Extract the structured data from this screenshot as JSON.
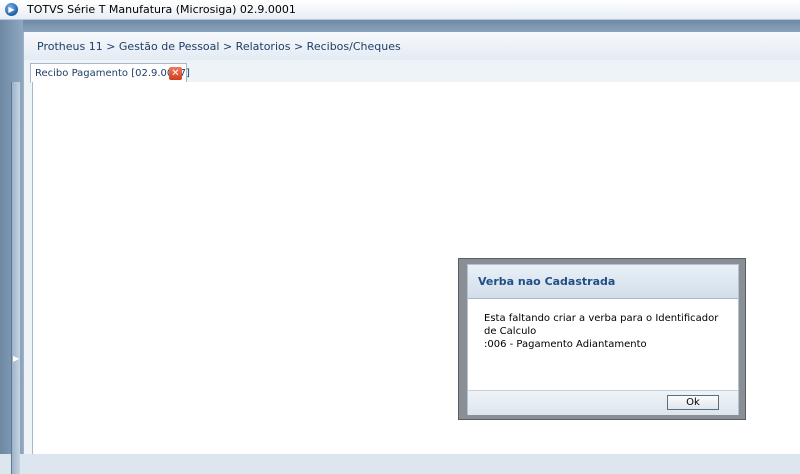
{
  "window": {
    "title": "TOTVS Série T Manufatura (Microsiga) 02.9.0001",
    "icon": "totvs-app-icon"
  },
  "breadcrumb": {
    "text": "Protheus 11 > Gestão de Pessoal > Relatorios > Recibos/Cheques"
  },
  "tabs": [
    {
      "label": "Recibo Pagamento [02.9.0007]",
      "active": true,
      "close_icon": "close-icon"
    }
  ],
  "dialog": {
    "title": "Verba nao Cadastrada",
    "message_line1": "Esta faltando criar a verba para o Identificador de Calculo",
    "message_line2": ":006 - Pagamento Adiantamento",
    "ok_label": "Ok"
  },
  "colors": {
    "title_text": "#1f4f86",
    "breadcrumb_text": "#1f3f66",
    "frame": "#7a94ae",
    "close_red": "#d13c1c"
  }
}
